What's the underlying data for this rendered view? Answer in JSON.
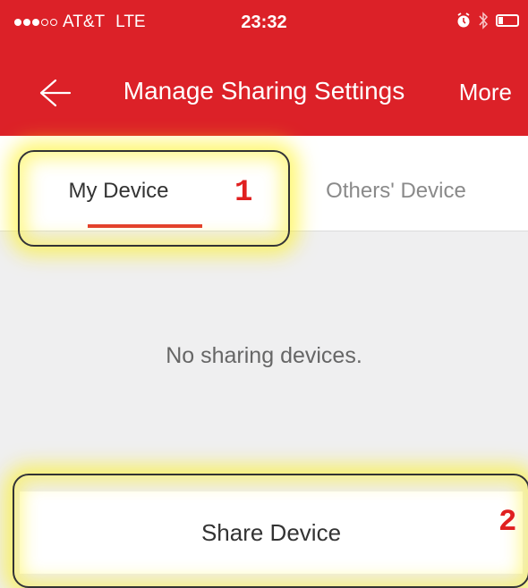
{
  "status_bar": {
    "signal_dots_filled": 3,
    "signal_dots_total": 5,
    "carrier": "AT&T",
    "network": "LTE",
    "time": "23:32",
    "icons": [
      "alarm-icon",
      "bluetooth-icon",
      "battery-icon"
    ],
    "battery_level": 0.2
  },
  "nav": {
    "back_icon": "back-arrow-icon",
    "title": "Manage Sharing Settings",
    "more_label": "More"
  },
  "tabs": [
    {
      "label": "My Device",
      "active": true
    },
    {
      "label": "Others' Device",
      "active": false
    }
  ],
  "empty_message": "No sharing devices.",
  "share_button_label": "Share Device",
  "annotations": {
    "marker_1": "1",
    "marker_2": "2"
  },
  "colors": {
    "brand_red": "#dc2128",
    "tab_indicator": "#e23b2c",
    "background": "#efeff0",
    "highlight_yellow": "#fff000",
    "marker_red": "#e02020"
  }
}
